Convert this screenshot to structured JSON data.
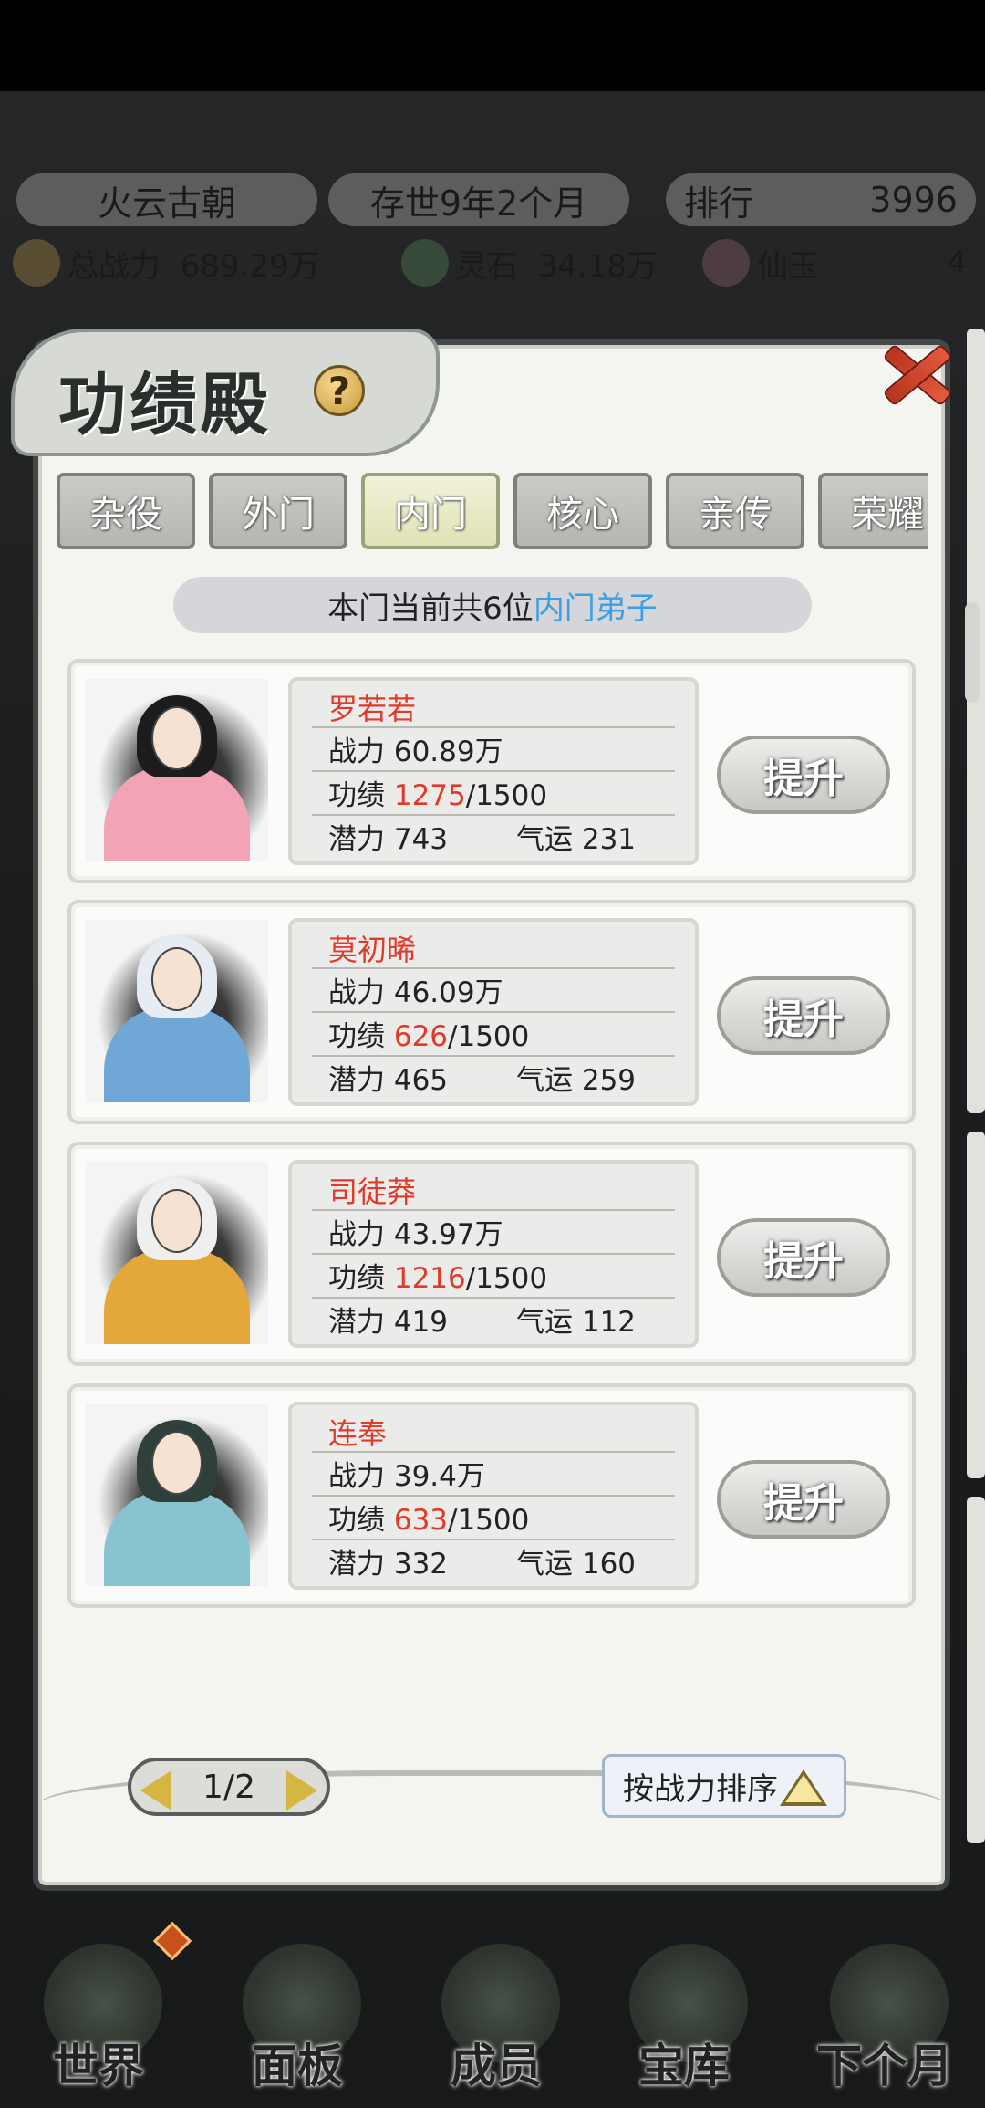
{
  "top_bar": {
    "dynasty": "火云古朝",
    "age": "存世9年2个月",
    "rank_label": "排行",
    "rank_value": "3996",
    "power_label": "总战力",
    "power_value": "689.29万",
    "lingshi_label": "灵石",
    "lingshi_value": "34.18万",
    "xianyu_label": "仙玉",
    "xianyu_value": "4"
  },
  "dialog": {
    "title": "功绩殿",
    "help": "?",
    "tabs": [
      {
        "label": "杂役",
        "active": false
      },
      {
        "label": "外门",
        "active": false
      },
      {
        "label": "内门",
        "active": true
      },
      {
        "label": "核心",
        "active": false
      },
      {
        "label": "亲传",
        "active": false
      },
      {
        "label": "荣耀",
        "active": false
      }
    ],
    "banner_prefix": "本门当前共6位",
    "banner_highlight": "内门弟子",
    "members": [
      {
        "name": "罗若若",
        "power_label": "战力",
        "power": "60.89万",
        "merit_label": "功绩",
        "merit": "1275",
        "merit_max": "/1500",
        "potential_label": "潜力",
        "potential": "743",
        "luck_label": "气运",
        "luck": "231",
        "button": "提升",
        "robe": "#f2a3b6",
        "hair": "#1c1c1c"
      },
      {
        "name": "莫初晞",
        "power_label": "战力",
        "power": "46.09万",
        "merit_label": "功绩",
        "merit": "626",
        "merit_max": "/1500",
        "potential_label": "潜力",
        "potential": "465",
        "luck_label": "气运",
        "luck": "259",
        "button": "提升",
        "robe": "#6fa7d6",
        "hair": "#e6ecf2"
      },
      {
        "name": "司徒莽",
        "power_label": "战力",
        "power": "43.97万",
        "merit_label": "功绩",
        "merit": "1216",
        "merit_max": "/1500",
        "potential_label": "潜力",
        "potential": "419",
        "luck_label": "气运",
        "luck": "112",
        "button": "提升",
        "robe": "#e4a83a",
        "hair": "#efefef"
      },
      {
        "name": "连奉",
        "power_label": "战力",
        "power": "39.4万",
        "merit_label": "功绩",
        "merit": "633",
        "merit_max": "/1500",
        "potential_label": "潜力",
        "potential": "332",
        "luck_label": "气运",
        "luck": "160",
        "button": "提升",
        "robe": "#88c4d0",
        "hair": "#2f3f3a"
      }
    ],
    "pager": "1/2",
    "sort_label": "按战力排序"
  },
  "bottom_nav": [
    {
      "label": "世界"
    },
    {
      "label": "面板"
    },
    {
      "label": "成员"
    },
    {
      "label": "宝库"
    },
    {
      "label": "下个月"
    }
  ],
  "colors": {
    "accent_red": "#e03a2a",
    "highlight_blue": "#3b9fe6",
    "arrow_gold": "#d6b642"
  }
}
